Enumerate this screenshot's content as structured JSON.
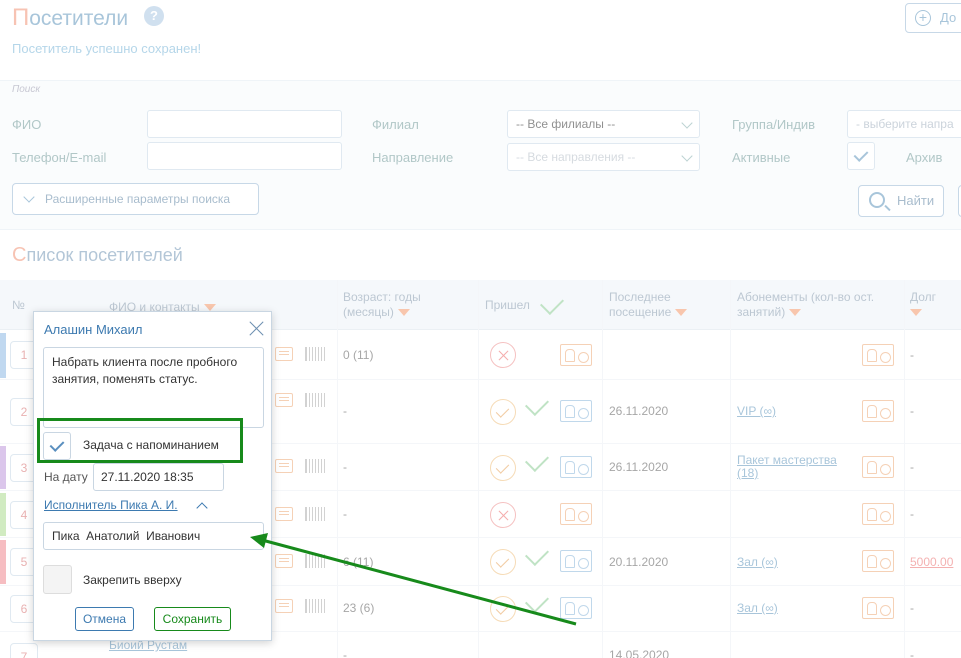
{
  "header": {
    "title_first": "П",
    "title_rest": "осетители",
    "help_icon": "?",
    "add_button": "До",
    "saved_message": "Посетитель успешно сохранен!"
  },
  "search": {
    "caption": "Поиск",
    "fio_label": "ФИО",
    "phone_label": "Телефон/E-mail",
    "branch_label": "Филиал",
    "branch_value": "-- Все филиалы --",
    "direction_label": "Направление",
    "direction_value": "-- Все направления --",
    "group_label": "Группа/Индив",
    "group_value": "- выберите напра",
    "active_label": "Активные",
    "archive_label": "Архив",
    "advanced_button": "Расширенные параметры поиска",
    "find_button": "Найти"
  },
  "list": {
    "title_first": "С",
    "title_rest": "писок посетителей",
    "columns": {
      "num": "№",
      "fio": "ФИО и контакты",
      "age": "Возраст: годы (месяцы)",
      "came": "Пришел",
      "last_visit": "Последнее посещение",
      "subscriptions": "Абонементы (кол-во ост. занятий)",
      "debt": "Долг"
    },
    "rows": [
      {
        "num": "1",
        "age": "0 (11)",
        "last": "",
        "sub": "",
        "debt": "-",
        "strip": "#9fc3e8"
      },
      {
        "num": "2",
        "age": "-",
        "last": "26.11.2020",
        "sub": "VIP (∞)",
        "debt": "-",
        "strip": "#ffffff"
      },
      {
        "num": "3",
        "age": "-",
        "last": "26.11.2020",
        "sub": "Пакет мастерства (18)",
        "debt": "-",
        "strip": "#c8a8e0"
      },
      {
        "num": "4",
        "age": "-",
        "last": "",
        "sub": "",
        "debt": "-",
        "strip": "#b9e0a0"
      },
      {
        "num": "5",
        "age": "6 (11)",
        "last": "20.11.2020",
        "sub": "Зал (∞)",
        "debt": "5000.00",
        "strip": "#f29aa0"
      },
      {
        "num": "6",
        "age": "23 (6)",
        "last": "",
        "sub": "Зал (∞)",
        "debt": "-",
        "strip": "#ffffff"
      },
      {
        "num": "7",
        "age": "-",
        "last": "14.05.2020",
        "sub": "",
        "debt": "-",
        "strip": "#ffffff",
        "fio": "Биоий Рустам"
      }
    ]
  },
  "popup": {
    "name": "Алашин Михаил",
    "task_text": "Набрать клиента после пробного занятия, поменять статус.",
    "reminder_label": "Задача с напоминанием",
    "date_label": "На дату",
    "date_value": "27.11.2020 18:35",
    "executor_link": "Исполнитель Пика А. И.",
    "executor_value": "Пика  Анатолий  Иванович",
    "pin_label": "Закрепить вверху",
    "cancel_button": "Отмена",
    "save_button": "Сохранить"
  },
  "colors": {
    "accent": "#7aa7c7",
    "highlight": "#178a1b"
  }
}
